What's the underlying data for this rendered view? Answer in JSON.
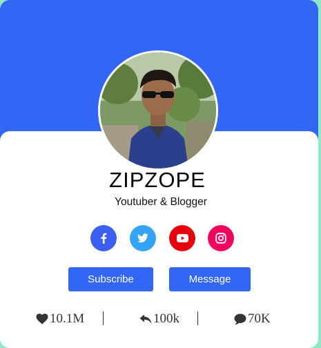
{
  "profile": {
    "name": "ZIPZOPE",
    "role": "Youtuber & Blogger"
  },
  "socials": [
    {
      "icon": "facebook-icon",
      "color": "#3b5ff1"
    },
    {
      "icon": "twitter-icon",
      "color": "#35a4f5"
    },
    {
      "icon": "youtube-icon",
      "color": "#e5040e"
    },
    {
      "icon": "instagram-icon",
      "color": "#f2055f"
    }
  ],
  "actions": {
    "subscribe_label": "Subscribe",
    "message_label": "Message"
  },
  "stats": {
    "likes": "10.1M",
    "shares": "100k",
    "comments": "70K"
  },
  "colors": {
    "accent": "#3366f5",
    "page_background": "#8ee9c4"
  }
}
